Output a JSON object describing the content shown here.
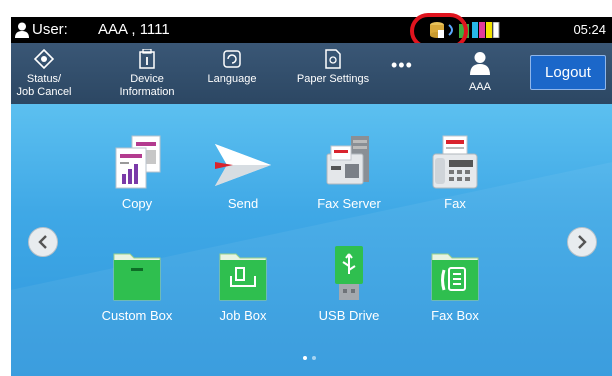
{
  "status_bar": {
    "user_label": "User:",
    "user_value": "AAA , 1111",
    "time": "05:24",
    "icons": [
      "user-icon",
      "toner-database-icon",
      "network-icon",
      "battery-icon",
      "toner-level-icon"
    ]
  },
  "toolbar": {
    "items": [
      {
        "label": "Status/\nJob Cancel",
        "icon": "status-icon"
      },
      {
        "label": "Device\nInformation",
        "icon": "device-info-icon"
      },
      {
        "label": "Language",
        "icon": "language-icon"
      },
      {
        "label": "Paper Settings",
        "icon": "paper-settings-icon"
      }
    ],
    "more_label": "•••",
    "user_name": "AAA",
    "logout_label": "Logout"
  },
  "tiles": [
    {
      "label": "Copy",
      "icon": "copy-icon"
    },
    {
      "label": "Send",
      "icon": "send-icon"
    },
    {
      "label": "Fax Server",
      "icon": "fax-server-icon"
    },
    {
      "label": "Fax",
      "icon": "fax-icon"
    },
    {
      "label": "Custom Box",
      "icon": "custom-box-icon"
    },
    {
      "label": "Job Box",
      "icon": "job-box-icon"
    },
    {
      "label": "USB Drive",
      "icon": "usb-drive-icon"
    },
    {
      "label": "Fax Box",
      "icon": "fax-box-icon"
    }
  ],
  "pagination": {
    "pages": 2,
    "current": 1
  },
  "colors": {
    "toolbar": "#2c4763",
    "logout": "#1b67c9",
    "background": "#3fa8e6",
    "highlight": "#e0141e",
    "folder_green": "#2fbf4f"
  }
}
